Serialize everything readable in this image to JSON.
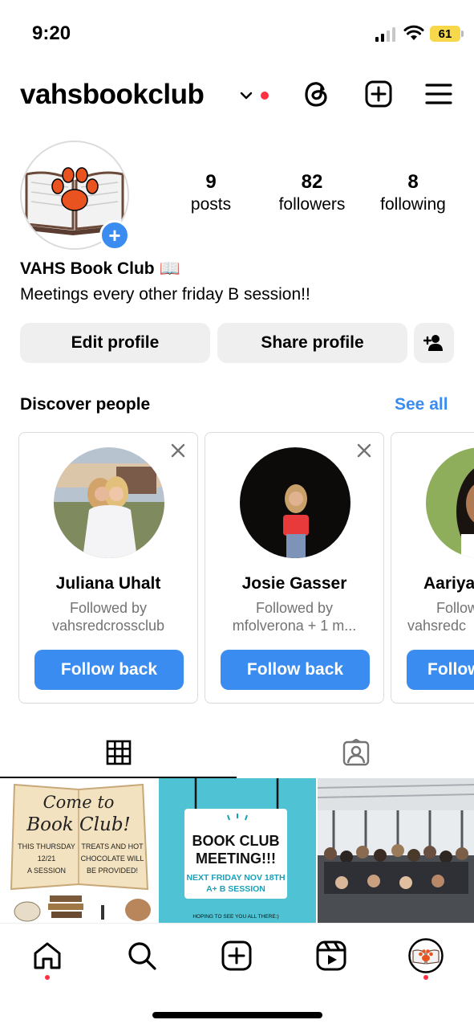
{
  "status_bar": {
    "time": "9:20",
    "battery": "61"
  },
  "header": {
    "username": "vahsbookclub"
  },
  "profile": {
    "stats": [
      {
        "value": "9",
        "label": "posts"
      },
      {
        "value": "82",
        "label": "followers"
      },
      {
        "value": "8",
        "label": "following"
      }
    ],
    "display_name": "VAHS Book Club 📖",
    "bio": "Meetings every other friday B session!!"
  },
  "actions": {
    "edit_profile": "Edit profile",
    "share_profile": "Share profile"
  },
  "discover": {
    "title": "Discover people",
    "see_all": "See all",
    "cards": [
      {
        "name": "Juliana Uhalt",
        "line1": "Followed by",
        "line2": "vahsredcrossclub",
        "button": "Follow back"
      },
      {
        "name": "Josie Gasser",
        "line1": "Followed by",
        "line2": "mfolverona + 1 m...",
        "button": "Follow back"
      },
      {
        "name": "Aariya",
        "line1": "Follow",
        "line2": "vahsredc",
        "button": "Follow"
      }
    ]
  },
  "posts": {
    "post1": {
      "line1": "Come to",
      "line2": "Book Club!",
      "left_col": [
        "THIS THURSDAY",
        "12/21",
        "A SESSION"
      ],
      "right_col": [
        "TREATS AND HOT",
        "CHOCOLATE WILL",
        "BE PROVIDED!"
      ]
    },
    "post2": {
      "title1": "BOOK CLUB",
      "title2": "MEETING!!!",
      "sub1": "NEXT FRIDAY NOV 18TH",
      "sub2": "A+ B SESSION",
      "footer": "HOPING TO SEE YOU ALL THERE:)"
    }
  },
  "icons": {
    "chevron": "chevron-down-icon",
    "threads": "threads-icon",
    "create": "plus-square-icon",
    "menu": "hamburger-menu-icon",
    "add_person": "add-person-icon",
    "grid": "grid-icon",
    "tagged": "tagged-icon",
    "home": "home-icon",
    "search": "search-icon",
    "reels": "reels-icon"
  },
  "colors": {
    "accent": "#3a8cf0",
    "notification": "#ff3040",
    "battery": "#f7d84a",
    "button_bg": "#efefef",
    "tile_blue": "#4fc2d4"
  }
}
